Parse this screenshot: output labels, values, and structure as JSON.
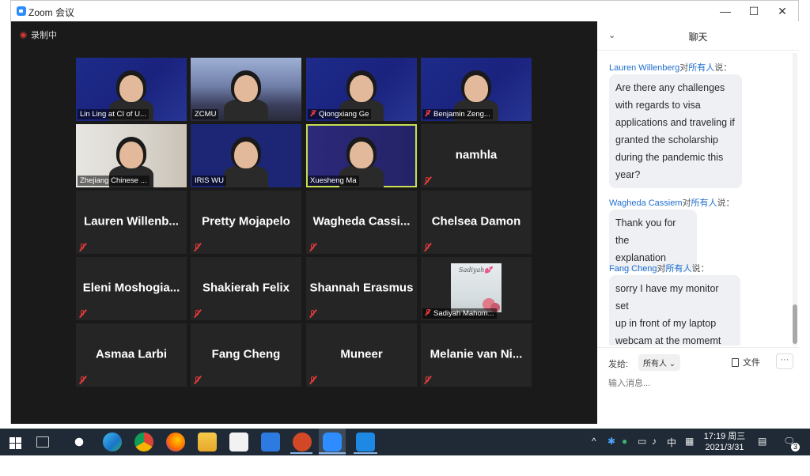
{
  "window": {
    "title": "Zoom 会议",
    "minimize": "—",
    "maximize": "☐",
    "close": "✕"
  },
  "recording": {
    "label": "录制中"
  },
  "tiles": [
    {
      "name": "Lin Ling at CI of U...",
      "type": "video",
      "scene": "blue",
      "muted": false
    },
    {
      "name": "ZCMU",
      "type": "video",
      "scene": "city",
      "muted": false
    },
    {
      "name": "Qiongxiang Ge",
      "type": "video",
      "scene": "blue",
      "muted": true
    },
    {
      "name": "Benjamin Zeng...",
      "type": "video",
      "scene": "blue",
      "muted": true
    },
    {
      "name": "Zhejiang Chinese ...",
      "type": "video",
      "scene": "room",
      "muted": false
    },
    {
      "name": "IRIS WU",
      "type": "video",
      "scene": "crest",
      "muted": false
    },
    {
      "name": "Xuesheng Ma",
      "type": "video",
      "scene": "univ",
      "muted": false,
      "active": true
    },
    {
      "name": "namhla",
      "type": "name",
      "muted": true
    },
    {
      "name": "Lauren  Willenb...",
      "type": "name",
      "muted": true
    },
    {
      "name": "Pretty Mojapelo",
      "type": "name",
      "muted": true
    },
    {
      "name": "Wagheda  Cassi...",
      "type": "name",
      "muted": true
    },
    {
      "name": "Chelsea Damon",
      "type": "name",
      "muted": true
    },
    {
      "name": "Eleni  Moshogia...",
      "type": "name",
      "muted": true
    },
    {
      "name": "Shakierah Felix",
      "type": "name",
      "muted": true
    },
    {
      "name": "Shannah Erasmus",
      "type": "name",
      "muted": true
    },
    {
      "name": "Sadiyah Mahom...",
      "type": "image",
      "muted": true,
      "image_text": "Sadiyah💕"
    },
    {
      "name": "Asmaa Larbi",
      "type": "name",
      "muted": true
    },
    {
      "name": "Fang Cheng",
      "type": "name",
      "muted": true
    },
    {
      "name": "Muneer",
      "type": "name",
      "muted": true
    },
    {
      "name": "Melanie van Ni...",
      "type": "name",
      "muted": true
    }
  ],
  "chat": {
    "title": "聊天",
    "collapse_icon": "⌄",
    "messages": [
      {
        "from": "Lauren Willenberg",
        "to_prefix": "对",
        "to": "所有人",
        "suffix": "说：",
        "lines": [
          "Are there any challenges",
          "with regards to visa",
          "applications and traveling if",
          "granted the scholarship",
          "during the pandemic this",
          "year?"
        ]
      },
      {
        "from": "Wagheda Cassiem",
        "to_prefix": "对",
        "to": "所有人",
        "suffix": "说：",
        "lines": [
          "Thank you for the",
          "explanation"
        ]
      },
      {
        "from": "Fang Cheng",
        "to_prefix": "对",
        "to": "所有人",
        "suffix": "说：",
        "lines": [
          "sorry I have my monitor set",
          "up in front of my laptop",
          "webcam at the momemt"
        ]
      }
    ],
    "send_to_label": "发给:",
    "recipient": "所有人",
    "file_label": "文件",
    "more_label": "···",
    "input_placeholder": "输入消息..."
  },
  "taskbar": {
    "clock_time": "17:19 周三",
    "clock_date": "2021/3/31",
    "ime": "中",
    "notifications_badge": "3",
    "tray_up": "^"
  },
  "colors": {
    "accent": "#2d8cff",
    "active_speaker": "#c8e051",
    "chat_name": "#1f6fcf",
    "mute_red": "#e03a3a"
  }
}
